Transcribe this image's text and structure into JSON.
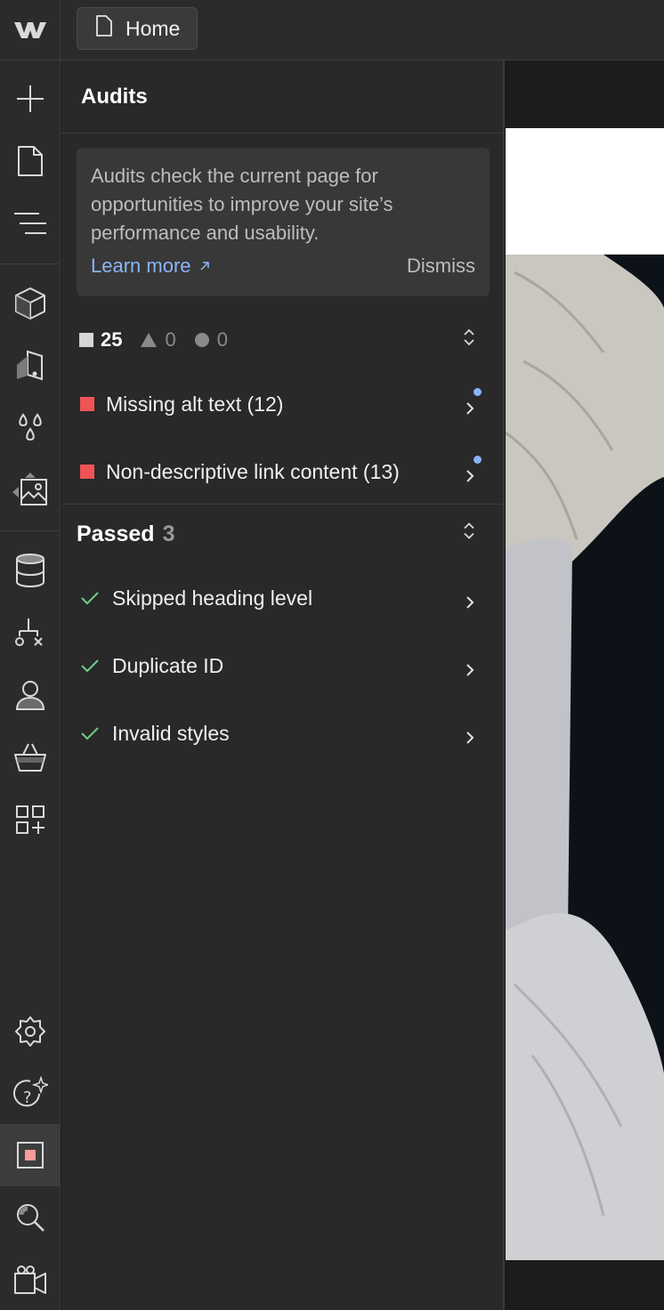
{
  "topbar": {
    "page_label": "Home",
    "logo_icon": "webflow-logo-icon",
    "page_icon": "page-icon"
  },
  "rail": {
    "items": [
      {
        "name": "add-icon"
      },
      {
        "name": "pages-icon"
      },
      {
        "name": "navigator-icon"
      },
      {
        "name": "components-icon"
      },
      {
        "name": "style-selectors-icon"
      },
      {
        "name": "variables-icon"
      },
      {
        "name": "assets-icon"
      },
      {
        "name": "cms-icon"
      },
      {
        "name": "logic-icon"
      },
      {
        "name": "users-icon"
      },
      {
        "name": "ecommerce-icon"
      },
      {
        "name": "apps-icon"
      },
      {
        "name": "settings-icon"
      },
      {
        "name": "help-ai-icon"
      },
      {
        "name": "audits-icon",
        "active": true
      },
      {
        "name": "search-icon"
      },
      {
        "name": "video-tutorials-icon"
      }
    ]
  },
  "panel": {
    "title": "Audits",
    "info": {
      "text": "Audits check the current page for opportunities to improve your site’s performance and usability.",
      "learn_more": "Learn more",
      "dismiss": "Dismiss"
    },
    "summary": {
      "errors": "25",
      "warnings": "0",
      "suggestions": "0"
    },
    "issues": [
      {
        "label": "Missing alt text (12)",
        "new": true
      },
      {
        "label": "Non-descriptive link content (13)",
        "new": true
      }
    ],
    "passed": {
      "label": "Passed",
      "count": "3",
      "items": [
        {
          "label": "Skipped heading level"
        },
        {
          "label": "Duplicate ID"
        },
        {
          "label": "Invalid styles"
        }
      ]
    }
  },
  "colors": {
    "error": "#f05454",
    "success": "#6fcf87",
    "link": "#8ab4f8",
    "panel_bg": "#292929"
  }
}
